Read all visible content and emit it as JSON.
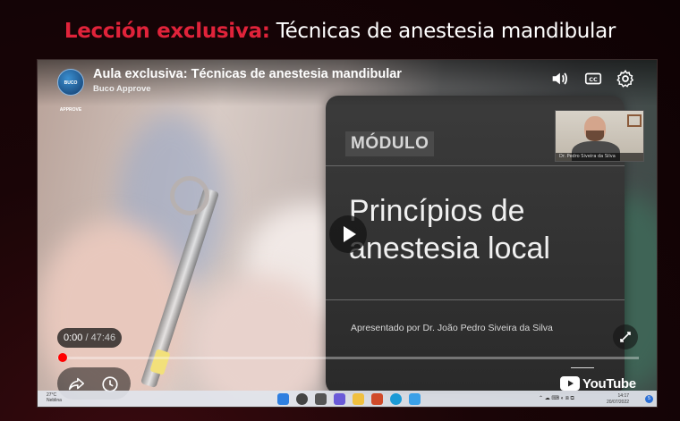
{
  "page": {
    "heading_accent": "Lección exclusiva:",
    "heading_rest": " Técnicas de anestesia mandibular"
  },
  "player": {
    "title": "Aula exclusiva: Técnicas de anestesia mandibular",
    "channel": "Buco Approve",
    "avatar_text": "BUCO APPROVE",
    "current_time": "0:00",
    "separator": " / ",
    "duration": "47:46",
    "progress_fraction": 0.0,
    "logo_text": "YouTube",
    "icons": {
      "volume": "volume-icon",
      "captions": "cc-icon",
      "settings": "gear-icon",
      "play": "play-icon",
      "share": "share-icon",
      "watch_later": "clock-icon",
      "fullscreen": "fullscreen-icon"
    },
    "colors": {
      "progress": "#ff0000",
      "accent": "#e0233a"
    }
  },
  "slide": {
    "module_label": "MÓDULO",
    "title_line1": "Princípios de",
    "title_line2": "anestesia local",
    "presenter": "Apresentado por Dr. João Pedro Siveira da Silva"
  },
  "webcam": {
    "label": "Dr. Pedro Siveira da Silva"
  },
  "taskbar": {
    "weather_temp": "27°C",
    "weather_desc": "Neblina",
    "time": "14:17",
    "date": "20/07/2022",
    "notifications": "5"
  }
}
